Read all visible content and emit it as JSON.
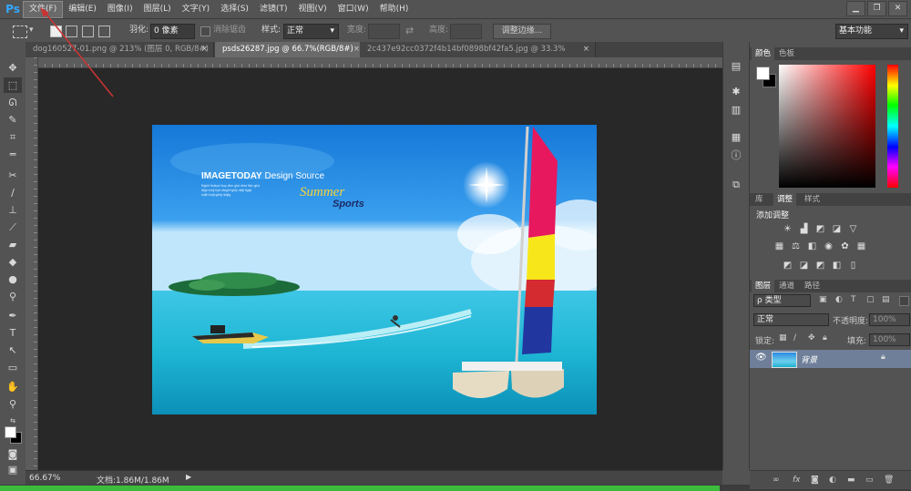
{
  "app": {
    "logo": "Ps"
  },
  "menu": {
    "items": [
      "文件(F)",
      "编辑(E)",
      "图像(I)",
      "图层(L)",
      "文字(Y)",
      "选择(S)",
      "滤镜(T)",
      "视图(V)",
      "窗口(W)",
      "帮助(H)"
    ],
    "active_index": 0
  },
  "window_controls": {
    "minimize": "▁",
    "restore": "❐",
    "close": "✕"
  },
  "options": {
    "feather_label": "羽化:",
    "feather_value": "0 像素",
    "antialias_label": "消除锯齿",
    "style_label": "样式:",
    "style_value": "正常",
    "width_label": "宽度:",
    "height_label": "高度:",
    "refine_button": "调整边缘...",
    "workspace_value": "基本功能"
  },
  "tabs": [
    {
      "label": "dog160527-01.png @ 213% (图层 0, RGB/8#)",
      "active": false
    },
    {
      "label": "psds26287.jpg @ 66.7%(RGB/8#)",
      "active": true
    },
    {
      "label": "2c437e92cc0372f4b14bf0898bf42fa5.jpg @ 33.3%(RGB/8#)",
      "active": false
    }
  ],
  "tab_close": "×",
  "image": {
    "title_bold": "IMAGETODAY",
    "title_rest": " Design Source",
    "word1": "Summer",
    "word2": "Sports",
    "small_lines": [
      "Rgkhf lkdkyrt liruy dfvn gfut dfret lfidr glkd",
      "ikfgh lirkjl lejrt dfsghf lgkfjr dkfji flgkjf",
      "kdjfh lkdjf gkfdj lkdjfg"
    ]
  },
  "status": {
    "zoom": "66.67%",
    "doc": "文档:1.86M/1.86M"
  },
  "color_panel": {
    "tabs": [
      "颜色",
      "色板"
    ]
  },
  "adjust_panel": {
    "tabs": [
      "库",
      "调整",
      "样式"
    ],
    "heading": "添加调整"
  },
  "layers_panel": {
    "tabs": [
      "图层",
      "通道",
      "路径"
    ],
    "filter_kind": "ρ 类型",
    "blend_mode": "正常",
    "opacity_label": "不透明度:",
    "opacity_value": "100%",
    "lock_label": "锁定:",
    "fill_label": "填充:",
    "fill_value": "100%",
    "layer_name": "背景"
  },
  "colors": {
    "accent": "#31a8ff",
    "highlight_red": "#cc3333",
    "green_bar": "#3dbb3d"
  }
}
